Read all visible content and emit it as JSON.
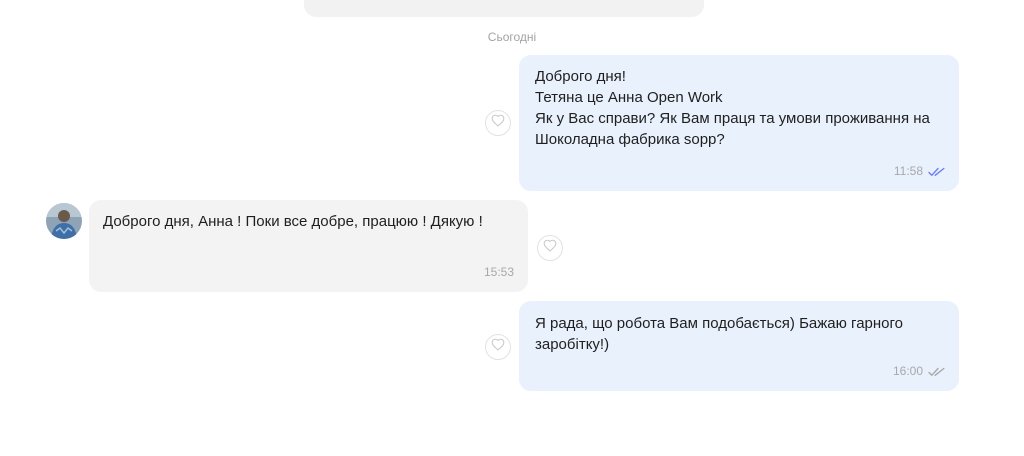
{
  "date_separator": "Сьогодні",
  "messages": [
    {
      "direction": "out",
      "text": "Доброго дня!\nТетяна це Анна Open Work\nЯк у Вас справи? Як Вам праця та умови проживання на Шоколадна фабрика sopp?",
      "time": "11:58",
      "status": "read"
    },
    {
      "direction": "in",
      "text": "Доброго дня, Анна ! Поки все добре, працюю ! Дякую !",
      "time": "15:53"
    },
    {
      "direction": "out",
      "text": "Я рада, що робота Вам подобається) Бажаю гарного заробітку!)",
      "time": "16:00",
      "status": "delivered"
    }
  ],
  "colors": {
    "outgoing_bubble": "#e9f1fd",
    "incoming_bubble": "#f3f3f3",
    "read_check": "#6c7ff0",
    "delivered_check": "#a8a8a8"
  },
  "icons": {
    "like": "heart-outline-icon",
    "read": "double-check-icon",
    "delivered": "double-check-icon"
  }
}
